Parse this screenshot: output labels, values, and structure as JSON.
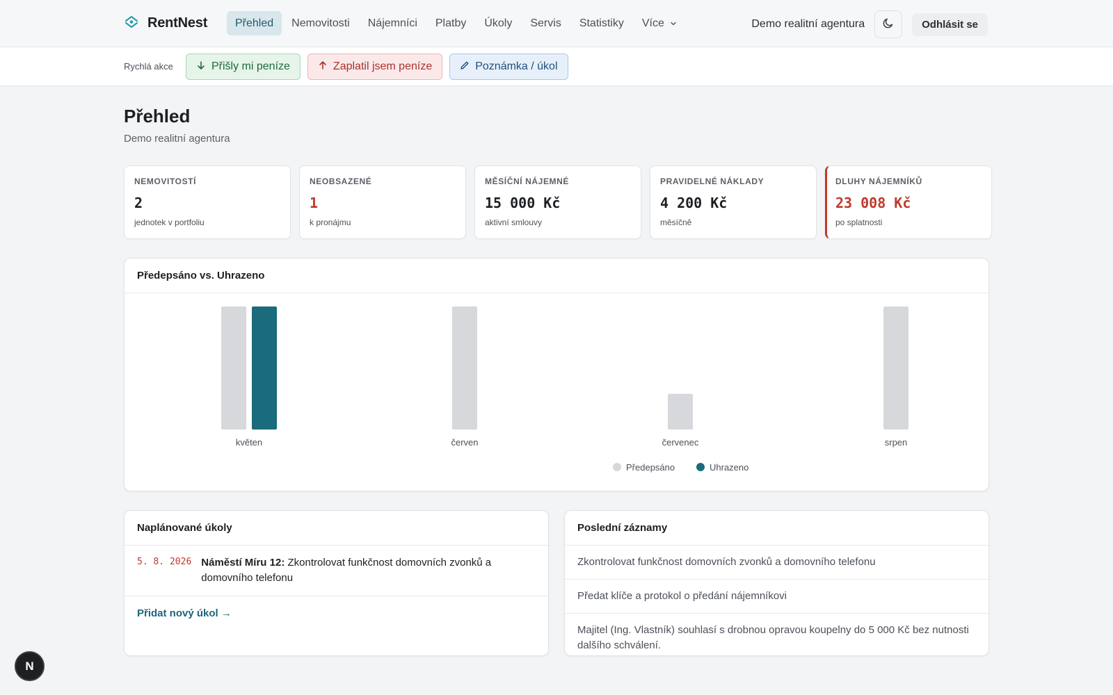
{
  "brand": {
    "name": "RentNest"
  },
  "nav": {
    "items": [
      {
        "label": "Přehled",
        "active": true
      },
      {
        "label": "Nemovitosti"
      },
      {
        "label": "Nájemníci"
      },
      {
        "label": "Platby"
      },
      {
        "label": "Úkoly"
      },
      {
        "label": "Servis"
      },
      {
        "label": "Statistiky"
      },
      {
        "label": "Více"
      }
    ],
    "agency": "Demo realitní agentura",
    "logout": "Odhlásit se"
  },
  "quick": {
    "label": "Rychlá akce",
    "actions": [
      {
        "label": "Přišly mi peníze"
      },
      {
        "label": "Zaplatil jsem peníze"
      },
      {
        "label": "Poznámka / úkol"
      }
    ]
  },
  "page": {
    "title": "Přehled",
    "subtitle": "Demo realitní agentura"
  },
  "stats": [
    {
      "label": "NEMOVITOSTÍ",
      "value": "2",
      "note": "jednotek v portfoliu"
    },
    {
      "label": "NEOBSAZENÉ",
      "value": "1",
      "note": "k pronájmu"
    },
    {
      "label": "MĚSÍČNÍ NÁJEMNÉ",
      "value": "15 000 Kč",
      "note": "aktivní smlouvy"
    },
    {
      "label": "PRAVIDELNÉ NÁKLADY",
      "value": "4 200 Kč",
      "note": "měsíčně"
    },
    {
      "label": "DLUHY NÁJEMNÍKŮ",
      "value": "23 008 Kč",
      "note": "po splatnosti"
    }
  ],
  "chart_card": {
    "title": "Předepsáno vs. Uhrazeno"
  },
  "chart_data": {
    "type": "bar",
    "categories": [
      "květen",
      "červen",
      "červenec",
      "srpen"
    ],
    "series": [
      {
        "name": "Předepsáno",
        "color": "#d6d8db",
        "values": [
          1,
          1,
          0.29,
          1
        ]
      },
      {
        "name": "Uhrazeno",
        "color": "#1a6b7c",
        "values": [
          1,
          0,
          0,
          0
        ]
      }
    ],
    "ylim": [
      0,
      1
    ],
    "grid": false,
    "legend": "bottom-center"
  },
  "tasks": {
    "title": "Naplánované úkoly",
    "items": [
      {
        "date": "5. 8. 2026",
        "place": "Náměstí Míru 12:",
        "text": " Zkontrolovat funkčnost domovních zvonků a domovního telefonu"
      }
    ],
    "add_label": "Přidat nový úkol →"
  },
  "log": {
    "title": "Poslední záznamy",
    "items": [
      "Zkontrolovat funkčnost domovních zvonků a domovního telefonu",
      "Předat klíče a protokol o předání nájemníkovi",
      "Majitel (Ing. Vlastník) souhlasí s drobnou opravou koupelny do 5 000 Kč bez nutnosti dalšího schválení."
    ]
  },
  "fab": {
    "label": "N"
  }
}
